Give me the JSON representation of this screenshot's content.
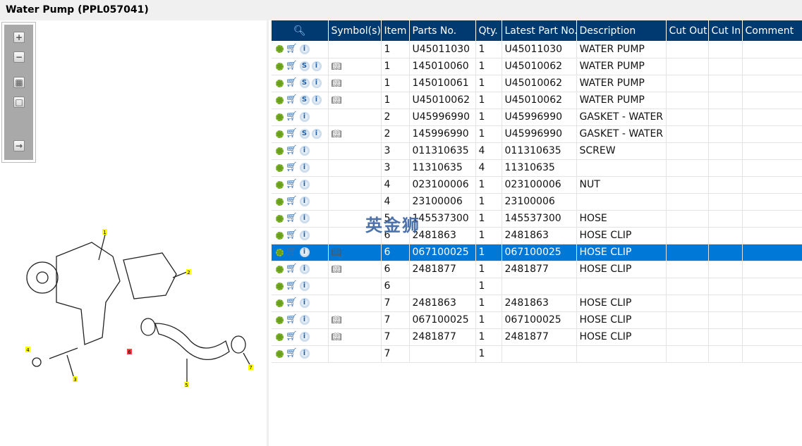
{
  "title": "Water Pump (PPL057041)",
  "watermark": "英金狮",
  "columns": [
    "Symbol(s)",
    "Item",
    "Parts No.",
    "Qty.",
    "Latest Part No.",
    "Description",
    "Cut Out",
    "Cut In",
    "Comment"
  ],
  "rows": [
    {
      "s": false,
      "book": false,
      "item": "1",
      "part": "U45011030",
      "qty": "1",
      "latest": "U45011030",
      "desc": "WATER PUMP"
    },
    {
      "s": true,
      "book": true,
      "item": "1",
      "part": "145010060",
      "qty": "1",
      "latest": "U45010062",
      "desc": "WATER PUMP"
    },
    {
      "s": true,
      "book": true,
      "item": "1",
      "part": "145010061",
      "qty": "1",
      "latest": "U45010062",
      "desc": "WATER PUMP"
    },
    {
      "s": true,
      "book": true,
      "item": "1",
      "part": "U45010062",
      "qty": "1",
      "latest": "U45010062",
      "desc": "WATER PUMP"
    },
    {
      "s": false,
      "book": false,
      "item": "2",
      "part": "U45996990",
      "qty": "1",
      "latest": "U45996990",
      "desc": "GASKET - WATER PUMP"
    },
    {
      "s": true,
      "book": true,
      "item": "2",
      "part": "145996990",
      "qty": "1",
      "latest": "U45996990",
      "desc": "GASKET - WATER PUMP"
    },
    {
      "s": false,
      "book": false,
      "item": "3",
      "part": "011310635",
      "qty": "4",
      "latest": "011310635",
      "desc": "SCREW"
    },
    {
      "s": false,
      "book": false,
      "item": "3",
      "part": "11310635",
      "qty": "4",
      "latest": "11310635",
      "desc": ""
    },
    {
      "s": false,
      "book": false,
      "item": "4",
      "part": "023100006",
      "qty": "1",
      "latest": "023100006",
      "desc": "NUT"
    },
    {
      "s": false,
      "book": false,
      "item": "4",
      "part": "23100006",
      "qty": "1",
      "latest": "23100006",
      "desc": ""
    },
    {
      "s": false,
      "book": false,
      "item": "5",
      "part": "145537300",
      "qty": "1",
      "latest": "145537300",
      "desc": "HOSE"
    },
    {
      "s": false,
      "book": false,
      "item": "6",
      "part": "2481863",
      "qty": "1",
      "latest": "2481863",
      "desc": "HOSE CLIP"
    },
    {
      "s": false,
      "book": true,
      "item": "6",
      "part": "067100025",
      "qty": "1",
      "latest": "067100025",
      "desc": "HOSE CLIP",
      "selected": true
    },
    {
      "s": false,
      "book": true,
      "item": "6",
      "part": "2481877",
      "qty": "1",
      "latest": "2481877",
      "desc": "HOSE CLIP"
    },
    {
      "s": false,
      "book": false,
      "item": "6",
      "part": "",
      "qty": "1",
      "latest": "",
      "desc": ""
    },
    {
      "s": false,
      "book": false,
      "item": "7",
      "part": "2481863",
      "qty": "1",
      "latest": "2481863",
      "desc": "HOSE CLIP"
    },
    {
      "s": false,
      "book": true,
      "item": "7",
      "part": "067100025",
      "qty": "1",
      "latest": "067100025",
      "desc": "HOSE CLIP"
    },
    {
      "s": false,
      "book": true,
      "item": "7",
      "part": "2481877",
      "qty": "1",
      "latest": "2481877",
      "desc": "HOSE CLIP"
    },
    {
      "s": false,
      "book": false,
      "item": "7",
      "part": "",
      "qty": "1",
      "latest": "",
      "desc": ""
    }
  ],
  "callouts": [
    "1",
    "2",
    "3",
    "4",
    "5",
    "6",
    "7"
  ],
  "colors": {
    "header": "#003a70",
    "selected": "#0078d7"
  }
}
